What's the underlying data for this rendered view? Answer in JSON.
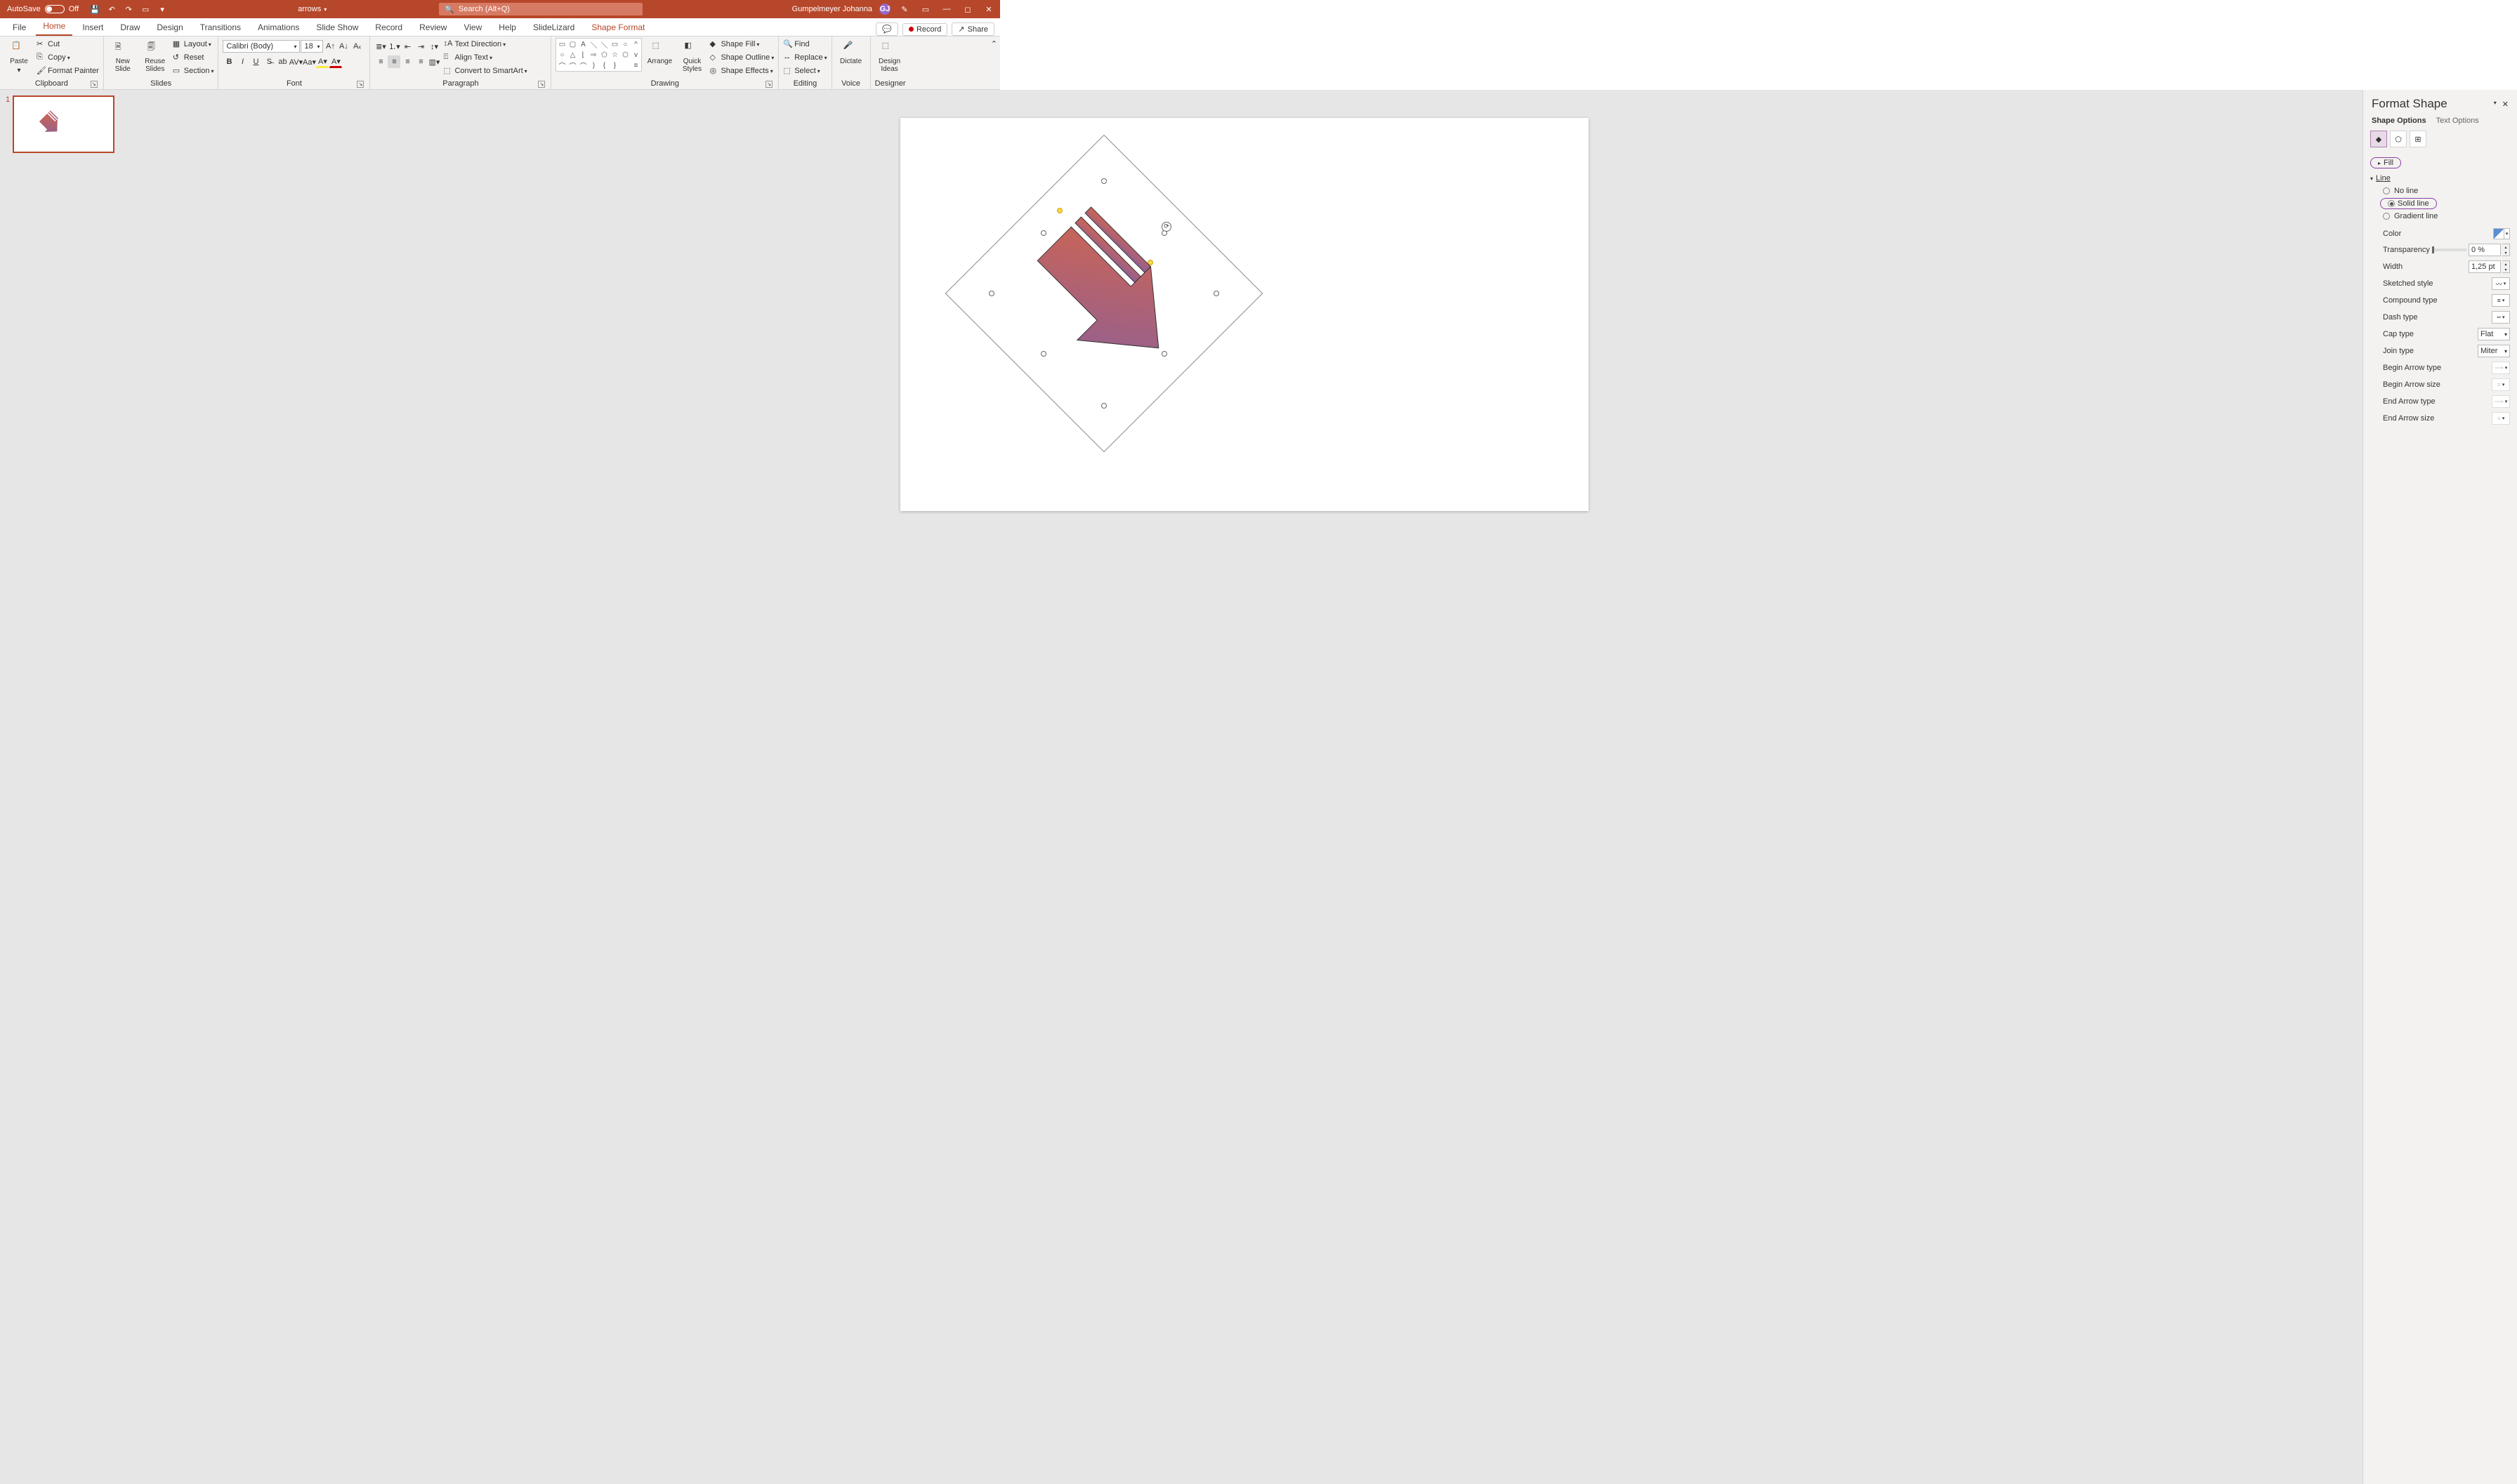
{
  "titlebar": {
    "autosave": "AutoSave",
    "autosave_state": "Off",
    "doc_name": "arrows",
    "search_placeholder": "Search (Alt+Q)",
    "user_name": "Gumpelmeyer Johanna",
    "user_initials": "GJ"
  },
  "tabs": {
    "file": "File",
    "home": "Home",
    "insert": "Insert",
    "draw": "Draw",
    "design": "Design",
    "transitions": "Transitions",
    "animations": "Animations",
    "slideshow": "Slide Show",
    "record": "Record",
    "review": "Review",
    "view": "View",
    "help": "Help",
    "slidelizard": "SlideLizard",
    "shapeformat": "Shape Format",
    "comments": "",
    "record_btn": "Record",
    "share": "Share"
  },
  "ribbon": {
    "clipboard": {
      "paste": "Paste",
      "cut": "Cut",
      "copy": "Copy",
      "format_painter": "Format Painter",
      "label": "Clipboard"
    },
    "slides": {
      "new_slide": "New\nSlide",
      "reuse_slides": "Reuse\nSlides",
      "layout": "Layout",
      "reset": "Reset",
      "section": "Section",
      "label": "Slides"
    },
    "font": {
      "name": "Calibri (Body)",
      "size": "18",
      "label": "Font"
    },
    "paragraph": {
      "text_direction": "Text Direction",
      "align_text": "Align Text",
      "convert_smartart": "Convert to SmartArt",
      "label": "Paragraph"
    },
    "drawing": {
      "arrange": "Arrange",
      "quick_styles": "Quick\nStyles",
      "shape_fill": "Shape Fill",
      "shape_outline": "Shape Outline",
      "shape_effects": "Shape Effects",
      "label": "Drawing"
    },
    "editing": {
      "find": "Find",
      "replace": "Replace",
      "select": "Select",
      "label": "Editing"
    },
    "voice": {
      "dictate": "Dictate",
      "label": "Voice"
    },
    "designer": {
      "design_ideas": "Design\nIdeas",
      "label": "Designer"
    }
  },
  "thumbs": {
    "slide1_num": "1"
  },
  "pane": {
    "title": "Format Shape",
    "shape_options": "Shape Options",
    "text_options": "Text Options",
    "fill": "Fill",
    "line": "Line",
    "no_line": "No line",
    "solid_line": "Solid line",
    "gradient_line": "Gradient line",
    "color": "Color",
    "transparency": "Transparency",
    "transparency_val": "0 %",
    "width": "Width",
    "width_val": "1,25 pt",
    "sketched": "Sketched style",
    "compound": "Compound type",
    "dash": "Dash type",
    "cap": "Cap type",
    "cap_val": "Flat",
    "join": "Join type",
    "join_val": "Miter",
    "begin_arrow_type": "Begin Arrow type",
    "begin_arrow_size": "Begin Arrow size",
    "end_arrow_type": "End Arrow type",
    "end_arrow_size": "End Arrow size"
  }
}
